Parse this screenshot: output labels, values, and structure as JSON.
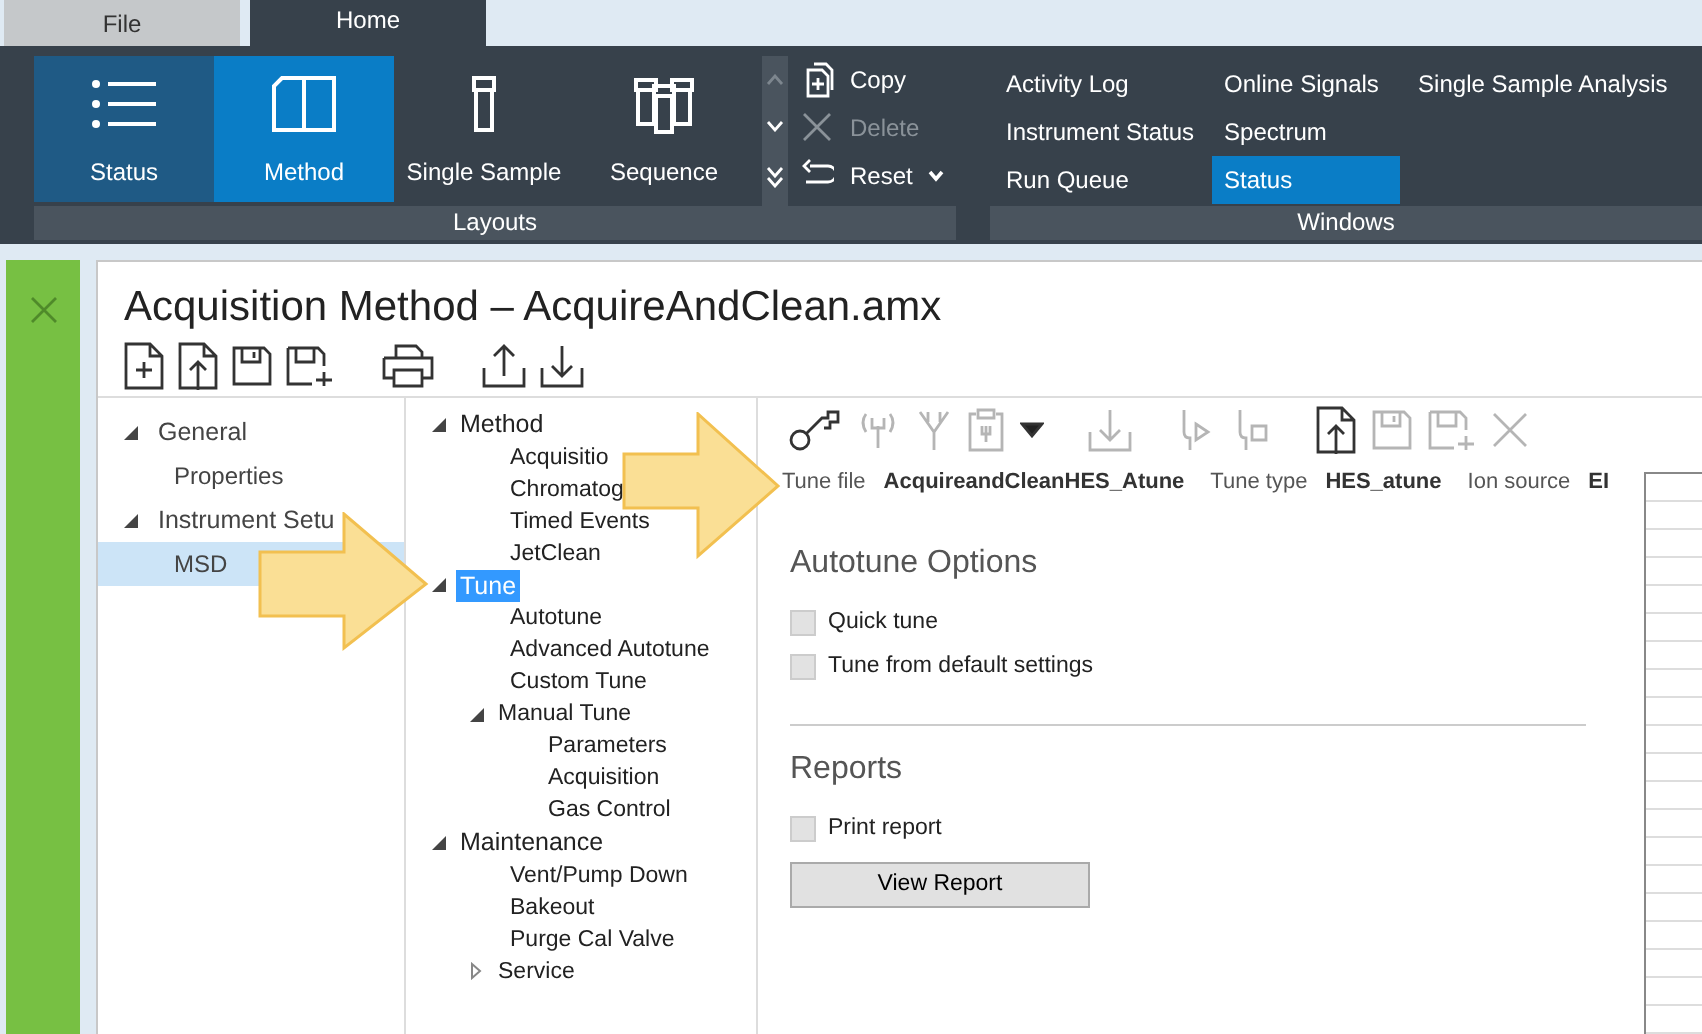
{
  "ribbon_tabs": [
    {
      "label": "File",
      "selected": false
    },
    {
      "label": "Home",
      "selected": true
    }
  ],
  "layouts": {
    "label": "Layouts",
    "buttons": [
      {
        "label": "Status",
        "kind": "status",
        "selected": false,
        "hovered": true
      },
      {
        "label": "Method",
        "kind": "method",
        "selected": true,
        "hovered": false
      },
      {
        "label": "Single Sample",
        "kind": "single",
        "selected": false,
        "hovered": false
      },
      {
        "label": "Sequence",
        "kind": "sequence",
        "selected": false,
        "hovered": false
      }
    ],
    "commands": [
      {
        "label": "Copy",
        "kind": "copy",
        "disabled": false,
        "dropdown": false
      },
      {
        "label": "Delete",
        "kind": "delete",
        "disabled": true,
        "dropdown": false
      },
      {
        "label": "Reset",
        "kind": "reset",
        "disabled": false,
        "dropdown": true
      }
    ]
  },
  "windows": {
    "label": "Windows",
    "columns": [
      [
        {
          "label": "Activity Log",
          "selected": false
        },
        {
          "label": "Instrument Status",
          "selected": false
        },
        {
          "label": "Run Queue",
          "selected": false
        }
      ],
      [
        {
          "label": "Online Signals",
          "selected": false
        },
        {
          "label": "Spectrum",
          "selected": false
        },
        {
          "label": "Status",
          "selected": true
        }
      ],
      [
        {
          "label": "Single Sample Analysis",
          "selected": false
        }
      ]
    ]
  },
  "document": {
    "title": "Acquisition Method – AcquireAndClean.amx",
    "toolbar": [
      {
        "kind": "new"
      },
      {
        "kind": "open"
      },
      {
        "kind": "save"
      },
      {
        "kind": "save-as"
      },
      {
        "kind": "print"
      },
      {
        "kind": "upload"
      },
      {
        "kind": "download"
      }
    ]
  },
  "nav_tree": [
    {
      "label": "General",
      "expanded": true,
      "children": [
        {
          "label": "Properties",
          "selected": false
        }
      ]
    },
    {
      "label": "Instrument Setu",
      "expanded": true,
      "children": [
        {
          "label": "MSD",
          "selected": true
        }
      ]
    }
  ],
  "method_tree": [
    {
      "label": "Method",
      "expanded": true,
      "selected": false,
      "children": [
        {
          "label": "Acquisitio",
          "selected": false
        },
        {
          "label": "Chromatog",
          "selected": false
        },
        {
          "label": "Timed Events",
          "selected": false
        },
        {
          "label": "JetClean",
          "selected": false
        }
      ]
    },
    {
      "label": "Tune",
      "expanded": true,
      "selected": true,
      "children": [
        {
          "label": "Autotune",
          "selected": false
        },
        {
          "label": "Advanced Autotune",
          "selected": false
        },
        {
          "label": "Custom Tune",
          "selected": false
        },
        {
          "label": "Manual Tune",
          "expanded": true,
          "selected": false,
          "children": [
            {
              "label": "Parameters",
              "selected": false
            },
            {
              "label": "Acquisition",
              "selected": false
            },
            {
              "label": "Gas Control",
              "selected": false
            }
          ]
        }
      ]
    },
    {
      "label": "Maintenance",
      "expanded": true,
      "selected": false,
      "children": [
        {
          "label": "Vent/Pump Down",
          "selected": false
        },
        {
          "label": "Bakeout",
          "selected": false
        },
        {
          "label": "Purge Cal Valve",
          "selected": false
        },
        {
          "label": "Service",
          "expanded": false,
          "selected": false
        }
      ]
    }
  ],
  "tune_toolbar": [
    {
      "kind": "key",
      "disabled": false
    },
    {
      "kind": "antenna",
      "disabled": true
    },
    {
      "kind": "tool",
      "disabled": true
    },
    {
      "kind": "clipboard",
      "disabled": true
    },
    {
      "kind": "menu",
      "disabled": false
    },
    {
      "kind": "import",
      "disabled": true
    },
    {
      "kind": "run",
      "disabled": true
    },
    {
      "kind": "stop",
      "disabled": true
    },
    {
      "kind": "open",
      "disabled": false
    },
    {
      "kind": "save",
      "disabled": true
    },
    {
      "kind": "save-as",
      "disabled": true
    },
    {
      "kind": "close",
      "disabled": true
    }
  ],
  "tune_info": [
    {
      "label": "Tune file",
      "value": "AcquireandCleanHES_Atune"
    },
    {
      "label": "Tune type",
      "value": "HES_atune"
    },
    {
      "label": "Ion source",
      "value": "EI"
    }
  ],
  "sections": [
    {
      "title": "Autotune Options",
      "checkboxes": [
        {
          "label": "Quick tune",
          "checked": false
        },
        {
          "label": "Tune from default settings",
          "checked": false
        }
      ]
    },
    {
      "title": "Reports",
      "checkboxes": [
        {
          "label": "Print report",
          "checked": false
        }
      ],
      "button": "View Report"
    }
  ]
}
